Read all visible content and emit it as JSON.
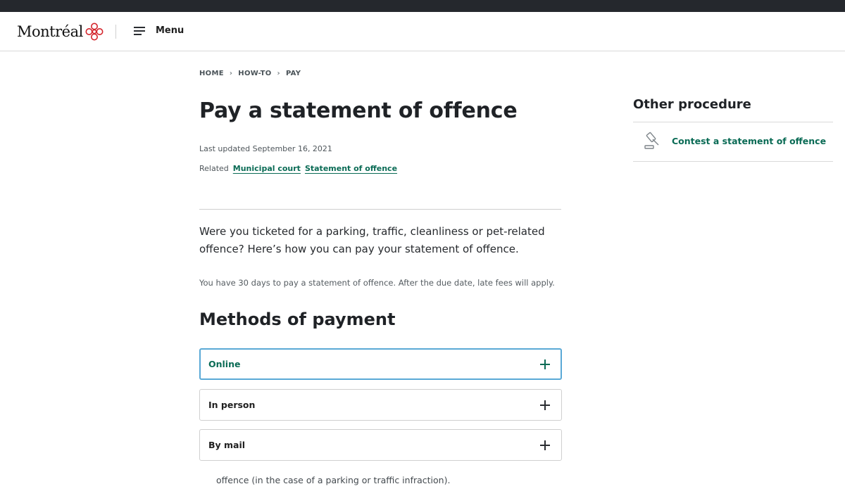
{
  "header": {
    "logo_text": "Montréal",
    "menu_label": "Menu"
  },
  "breadcrumb": [
    "HOME",
    "HOW-TO",
    "PAY"
  ],
  "page": {
    "title": "Pay a statement of offence",
    "last_updated": "Last updated September 16, 2021",
    "related_label": "Related",
    "related_tags": [
      "Municipal court",
      "Statement of offence"
    ],
    "lead": "Were you ticketed for a parking, traffic, cleanliness or pet-related offence? Here’s how you can pay your statement of offence.",
    "note": "You have 30 days to pay a statement of offence. After the due date, late fees will apply.",
    "section_title": "Methods of payment",
    "accordions": [
      {
        "label": "Online",
        "state": "focused"
      },
      {
        "label": "In person",
        "state": "collapsed"
      },
      {
        "label": "By mail",
        "state": "collapsed"
      }
    ],
    "peek_text": "offence (in the case of a parking or traffic infraction)."
  },
  "aside": {
    "title": "Other procedure",
    "link_label": "Contest a statement of offence",
    "link_icon": "gavel-icon"
  },
  "colors": {
    "accent_green": "#0a6b55",
    "focus_blue": "#5aa9d6",
    "logo_red": "#d4252c",
    "topbar": "#25282d"
  }
}
